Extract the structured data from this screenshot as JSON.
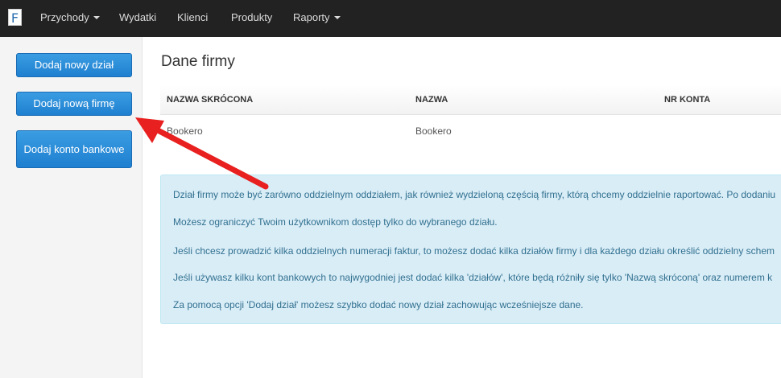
{
  "navbar": {
    "logo": "F",
    "items": [
      {
        "label": "Przychody",
        "has_dropdown": true
      },
      {
        "label": "Wydatki",
        "has_dropdown": false
      },
      {
        "label": "Klienci",
        "has_dropdown": false
      },
      {
        "label": "Produkty",
        "has_dropdown": false
      },
      {
        "label": "Raporty",
        "has_dropdown": true
      }
    ]
  },
  "sidebar": {
    "buttons": [
      {
        "label": "Dodaj nowy dział"
      },
      {
        "label": "Dodaj nową firmę"
      },
      {
        "label": "Dodaj konto bankowe"
      }
    ]
  },
  "main": {
    "title": "Dane firmy",
    "table": {
      "headers": [
        "NAZWA SKRÓCONA",
        "NAZWA",
        "NR KONTA"
      ],
      "rows": [
        [
          "Bookero",
          "Bookero",
          ""
        ]
      ]
    },
    "info": [
      "Dział firmy może być zarówno oddzielnym oddziałem, jak również wydzieloną częścią firmy, którą chcemy oddzielnie raportować. Po dodaniu",
      "Możesz ograniczyć Twoim użytkownikom dostęp tylko do wybranego działu.",
      "Jeśli chcesz prowadzić kilka oddzielnych numeracji faktur, to możesz dodać kilka działów firmy i dla każdego działu określić oddzielny schem",
      "Jeśli używasz kilku kont bankowych to najwygodniej jest dodać kilka 'działów', które będą różniły się tylko 'Nazwą skróconą' oraz numerem k",
      "Za pomocą opcji 'Dodaj dział' możesz szybko dodać nowy dział zachowując wcześniejsze dane."
    ]
  },
  "colors": {
    "navbar_bg": "#222222",
    "button_blue": "#1f7fd0",
    "info_bg": "#d9edf7",
    "info_text": "#31708f",
    "annotation_arrow": "#e8201f"
  }
}
